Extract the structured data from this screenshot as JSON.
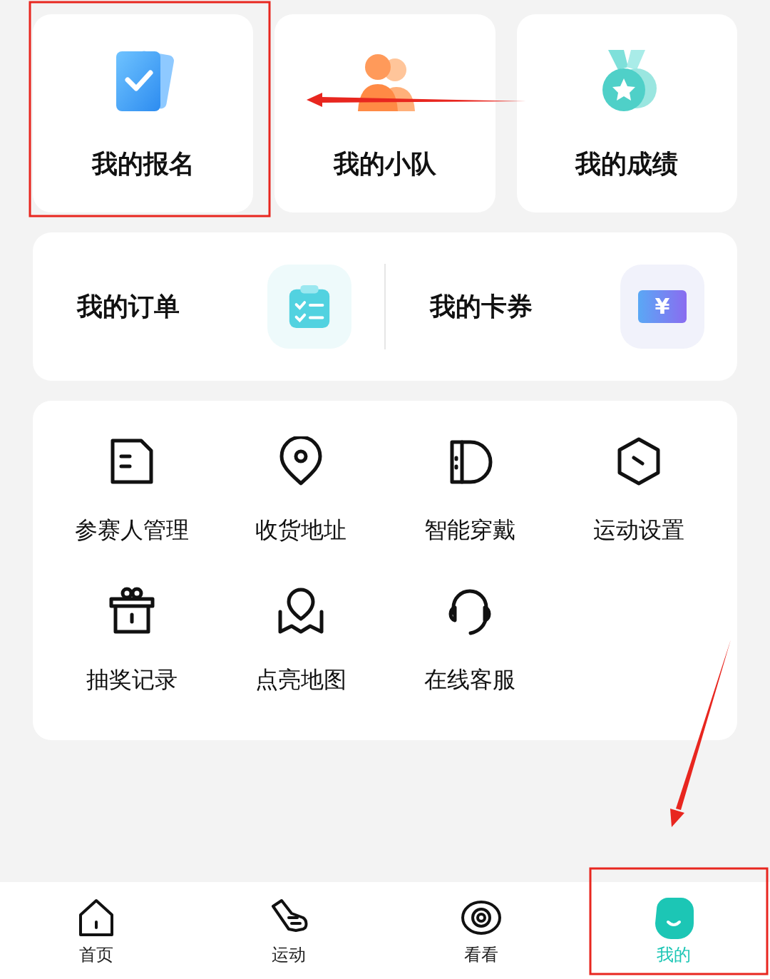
{
  "top_cards": [
    {
      "label": "我的报名",
      "kind": "signup"
    },
    {
      "label": "我的小队",
      "kind": "team"
    },
    {
      "label": "我的成绩",
      "kind": "score"
    }
  ],
  "shortcuts": [
    {
      "label": "我的订单",
      "kind": "orders"
    },
    {
      "label": "我的卡券",
      "kind": "coupons",
      "symbol": "¥"
    }
  ],
  "services": [
    {
      "label": "参赛人管理",
      "kind": "participants"
    },
    {
      "label": "收货地址",
      "kind": "address"
    },
    {
      "label": "智能穿戴",
      "kind": "wearable"
    },
    {
      "label": "运动设置",
      "kind": "settings"
    },
    {
      "label": "抽奖记录",
      "kind": "lottery"
    },
    {
      "label": "点亮地图",
      "kind": "map"
    },
    {
      "label": "在线客服",
      "kind": "support"
    }
  ],
  "nav": [
    {
      "label": "首页",
      "kind": "home",
      "selected": false
    },
    {
      "label": "运动",
      "kind": "sport",
      "selected": false
    },
    {
      "label": "看看",
      "kind": "watch",
      "selected": false
    },
    {
      "label": "我的",
      "kind": "mine",
      "selected": true
    }
  ]
}
